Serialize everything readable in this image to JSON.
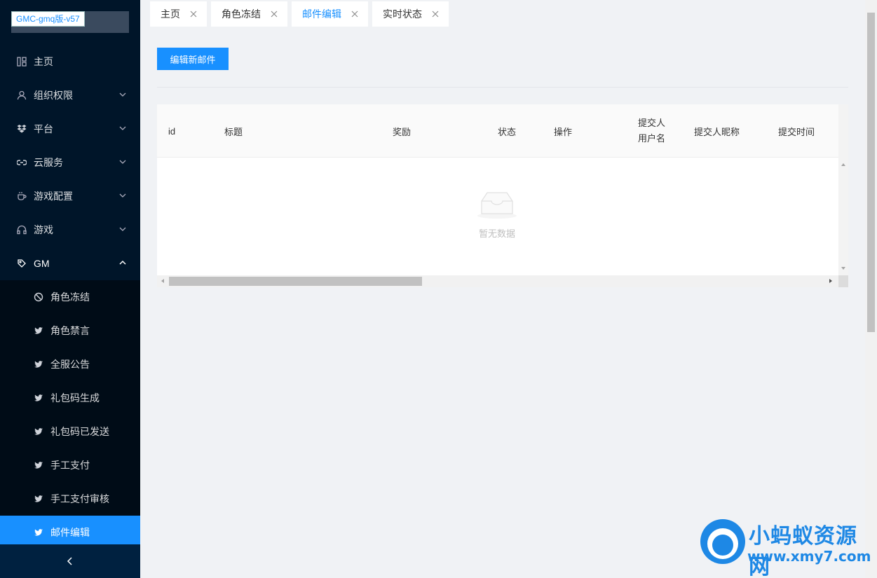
{
  "app": {
    "logo_text": "GMC-gmq版-v57"
  },
  "sidebar": {
    "items": [
      {
        "label": "主页",
        "icon": "home-grid-icon"
      },
      {
        "label": "组织权限",
        "icon": "user-icon"
      },
      {
        "label": "平台",
        "icon": "dropbox-icon"
      },
      {
        "label": "云服务",
        "icon": "link-icon"
      },
      {
        "label": "游戏配置",
        "icon": "coffee-icon"
      },
      {
        "label": "游戏",
        "icon": "headphones-icon"
      },
      {
        "label": "GM",
        "icon": "tag-icon"
      }
    ],
    "gm_children": [
      {
        "label": "角色冻结",
        "icon": "stop-icon"
      },
      {
        "label": "角色禁言",
        "icon": "twitter-icon"
      },
      {
        "label": "全服公告",
        "icon": "twitter-icon"
      },
      {
        "label": "礼包码生成",
        "icon": "twitter-icon"
      },
      {
        "label": "礼包码已发送",
        "icon": "twitter-icon"
      },
      {
        "label": "手工支付",
        "icon": "twitter-icon"
      },
      {
        "label": "手工支付审核",
        "icon": "twitter-icon"
      },
      {
        "label": "邮件编辑",
        "icon": "twitter-icon",
        "active": true
      }
    ]
  },
  "tabs": [
    {
      "label": "主页"
    },
    {
      "label": "角色冻结"
    },
    {
      "label": "邮件编辑",
      "active": true
    },
    {
      "label": "实时状态"
    }
  ],
  "toolbar": {
    "new_mail_label": "编辑新邮件"
  },
  "table": {
    "columns": [
      {
        "label": "id"
      },
      {
        "label": "标题"
      },
      {
        "label": "奖励"
      },
      {
        "label": "状态"
      },
      {
        "label": "操作"
      },
      {
        "label": "提交人用户名",
        "line1": "提交人",
        "line2": "用户名"
      },
      {
        "label": "提交人昵称"
      },
      {
        "label": "提交时间"
      }
    ],
    "empty_text": "暂无数据"
  },
  "watermark": {
    "title": "小蚂蚁资源网",
    "url": "www.xmy7.com"
  },
  "colors": {
    "primary": "#1890ff",
    "sidebar_bg": "#001529",
    "submenu_bg": "#000c17"
  }
}
